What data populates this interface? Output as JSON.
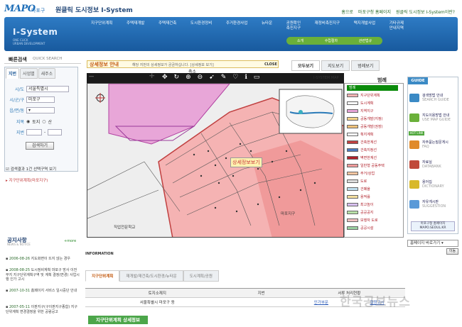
{
  "header": {
    "logo": "MAPO",
    "logo_sub": "마포구",
    "site_title": "원클릭 도시정보 I-System",
    "links": [
      "홈으로",
      "마포구청 홈페이지",
      "원클릭 도시정보 I-System이란?"
    ]
  },
  "band": {
    "title": "I-System",
    "subtitle": "ONE CLICK\nURBAN DEVELOPMENT"
  },
  "nav": [
    "지구단위계획",
    "주택재개발",
    "주택재건축",
    "도시환경정비",
    "주거환경사업",
    "뉴타운",
    "공원확인\n촉진지구",
    "재정비촉진지구",
    "택지개발사업",
    "기타규제\n안내지역"
  ],
  "subnav": [
    "소개",
    "수립절차",
    "관련법규"
  ],
  "search": {
    "title": "빠른검색",
    "title_en": "QUICK SEARCH",
    "tabs": [
      "지번",
      "사업별",
      "새주소"
    ],
    "si_label": "시/도",
    "si_value": "서울특별시",
    "gu_label": "시/군/구",
    "gu_value": "마포구",
    "dong_label": "읍/면/동",
    "jimok_label": "지목",
    "jimok_opt1": "토지",
    "jimok_opt2": "산",
    "jibun_label": "지번",
    "button": "검색하기",
    "toggle_text": "검색결과 1건 선택구역 보기",
    "region_text": "지구단위계획(마포지구)"
  },
  "infobar": {
    "title": "상세정보 안내",
    "text": "해당 지번의 상세정보가 궁금하십니다. [상세정보 보기]",
    "close": "CLOSE"
  },
  "view_tabs": [
    "모두보기",
    "지도보기",
    "범례보기"
  ],
  "toolbar": {
    "tip": "축소",
    "icons": [
      "pan-icon",
      "refresh-icon",
      "zoom-in-icon",
      "zoom-out-icon",
      "select-icon",
      "measure-icon",
      "area-icon",
      "info-icon",
      "print-icon"
    ]
  },
  "map": {
    "name": "I-SYSTEM MAP",
    "bubble": "상세정보보기",
    "label_a": "마포지구",
    "label_b": "직업전문학교"
  },
  "legend": {
    "title": "범례",
    "cap": "범례",
    "items": [
      "지구단위계획",
      "도시계획",
      "지역지구",
      "공동개발(지정)",
      "공동개발(권장)",
      "획지계획",
      "건축한계선",
      "건축지정선",
      "벽면한계선",
      "일반형 공동주택",
      "주거/상업",
      "도로",
      "건폐율",
      "용적률",
      "최고높이",
      "공공공지",
      "보행자 도로",
      "공공시설"
    ]
  },
  "guide": {
    "title": "GUIDE",
    "items": [
      "검색방법 안내",
      "지도이용방법 안내",
      "자주묻는질문게시",
      "자료실",
      "용어집",
      "자유게시판"
    ],
    "subs": [
      "SEARCH GUIDE",
      "USE MAP GUIDE",
      "FAQ",
      "DATABANK",
      "DICTIONARY",
      "SUGGESTION"
    ],
    "hot": "HOT LINK",
    "foot": "마포구청 홈페이지\nMAPO.SEOUL.KR"
  },
  "shortcut": {
    "label": "홈페이지 바로가기",
    "button": "이동"
  },
  "notices": {
    "title": "공지사항",
    "sub": "NEWS & NOTICE",
    "more": "+more",
    "items": [
      {
        "date": "2006-08-26",
        "text": "지도화면이 뜨지 않는 경우"
      },
      {
        "date": "2008-08-25",
        "text": "도시정비계획 마포구 망사 이전부지 지구단위계획구역 및 계획 결정(변경) 사업시행 인가 고시"
      },
      {
        "date": "2007-10-31",
        "text": "홈페이지 서비스 일시중단 안내"
      },
      {
        "date": "2007-05-11",
        "text": "이판지구(구이판지구종합) 지구단위계획 변경결정을 위한 공람공고"
      }
    ]
  },
  "bottom": {
    "head": "INFORMATION",
    "tabs": [
      "지구단위계획",
      "재개발/재건축/도시환경/뉴타운",
      "도시계획/공원"
    ],
    "headers": [
      "토지소재지",
      "지번",
      "서류 처리현황"
    ],
    "row": [
      "서울특별시 마포구",
      "동",
      "",
      "인가부문",
      "결정고시"
    ],
    "detail_button": "지구단위계획 상세정보"
  },
  "watermark": "한국공보뉴스"
}
